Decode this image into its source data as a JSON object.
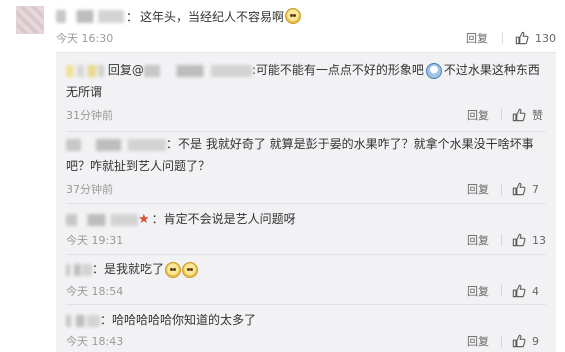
{
  "main_comment": {
    "separator": "：",
    "text": "这年头，当经纪人不容易啊",
    "emoji": "doge-face",
    "time": "今天 16:30",
    "reply_label": "回复",
    "like_count": "130"
  },
  "replies": [
    {
      "reply_prefix": "回复@",
      "separator": ":",
      "text_part1": "可能不能有一点点不好的形象吧",
      "emoji": "tear-face",
      "text_part2": "不过水果这种东西无所谓",
      "time": "31分钟前",
      "reply_label": "回复",
      "like_count": "赞"
    },
    {
      "separator": "：",
      "text": "不是 我就好奇了 就算是彭于晏的水果咋了？就拿个水果没干啥坏事吧？咋就扯到艺人问题了？",
      "time": "37分钟前",
      "reply_label": "回复",
      "like_count": "7"
    },
    {
      "separator": "：",
      "star": "★",
      "text": "肯定不会说是艺人问题呀",
      "time": "今天 19:31",
      "reply_label": "回复",
      "like_count": "13"
    },
    {
      "separator": "：",
      "text": "是我就吃了",
      "emoji": "doge-face",
      "time": "今天 18:54",
      "reply_label": "回复",
      "like_count": "4"
    },
    {
      "separator": "：",
      "text": "哈哈哈哈哈你知道的太多了",
      "time": "今天 18:43",
      "reply_label": "回复",
      "like_count": "9"
    }
  ],
  "colors": {
    "text": "#333333",
    "meta": "#999999",
    "panel_bg": "#f2f2f5",
    "star": "#e24a2b"
  },
  "icons": {
    "like": "thumbs-up-icon"
  }
}
